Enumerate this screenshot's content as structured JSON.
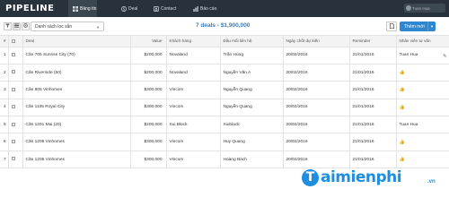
{
  "app": {
    "logo": "PIPELINE"
  },
  "nav": [
    {
      "label": "Bảng tin",
      "icon": "dashboard-icon",
      "active": true
    },
    {
      "label": "Deal",
      "icon": "dollar-icon",
      "active": false
    },
    {
      "label": "Contact",
      "icon": "contact-icon",
      "active": false
    },
    {
      "label": "Báo cáo",
      "icon": "chart-icon",
      "active": false
    }
  ],
  "user": {
    "name": "Tuan Hua"
  },
  "toolbar": {
    "filter_value": "Danh sách lọc sẵn",
    "summary": "7 deals - $1,900,000",
    "add_label": "Thêm mới"
  },
  "table": {
    "columns": [
      "#",
      "",
      "Deal",
      "Value",
      "Khách hàng",
      "Đầu mối liên hệ",
      "Ngày chốt dự kiến",
      "Reminder",
      "Nhân viên tư vấn"
    ],
    "rows": [
      {
        "idx": "1",
        "deal": "Căn 705 Sunrise City (70)",
        "value": "$200,000",
        "customer": "Novaland",
        "contact": "Trần Hùng",
        "close_date": "20/02/2016",
        "reminder": "21/01/2016",
        "staff": "Tuan Hua",
        "staff_icon": ""
      },
      {
        "idx": "2",
        "deal": "Căn Riverside (50)",
        "value": "$200,000",
        "customer": "Novaland",
        "contact": "Nguyễn Văn A",
        "close_date": "20/02/2016",
        "reminder": "21/01/2016",
        "staff": "",
        "staff_icon": "thumbs-up-icon"
      },
      {
        "idx": "3",
        "deal": "Căn 805 Vinhomes",
        "value": "$300,000",
        "customer": "Vincom",
        "contact": "Nguyễn Quang",
        "close_date": "20/02/2016",
        "reminder": "21/01/2016",
        "staff": "",
        "staff_icon": "thumbs-up-icon"
      },
      {
        "idx": "4",
        "deal": "Căn 1105 Royal City",
        "value": "$300,000",
        "customer": "Vincom",
        "contact": "Nguyễn Quang",
        "close_date": "20/02/2016",
        "reminder": "21/01/2016",
        "staff": "",
        "staff_icon": "thumbs-up-icon"
      },
      {
        "idx": "5",
        "deal": "Căn 1201 Mai (20)",
        "value": "$200,000",
        "customer": "Sui Block",
        "contact": "Siublack",
        "close_date": "20/02/2016",
        "reminder": "21/01/2016",
        "staff": "Tuan Hua",
        "staff_icon": ""
      },
      {
        "idx": "6",
        "deal": "Căn 1205 Vinhomes",
        "value": "$300,000",
        "customer": "Vincom",
        "contact": "Huy Quang",
        "close_date": "20/02/2016",
        "reminder": "21/01/2016",
        "staff": "",
        "staff_icon": "thumbs-up-icon"
      },
      {
        "idx": "7",
        "deal": "Căn 1205 Vinhomes",
        "value": "$300,000",
        "customer": "Vincom",
        "contact": "Hoàng Bách",
        "close_date": "20/02/2016",
        "reminder": "21/01/2016",
        "staff": "",
        "staff_icon": "thumbs-up-icon"
      }
    ]
  },
  "watermark": {
    "text": "aimienphi",
    "initial": "T",
    "suffix": ".vn"
  },
  "colors": {
    "nav_bg": "#27323c",
    "accent": "#2f87cf",
    "summary": "#3a7cc0",
    "watermark": "#1e8ee0"
  }
}
